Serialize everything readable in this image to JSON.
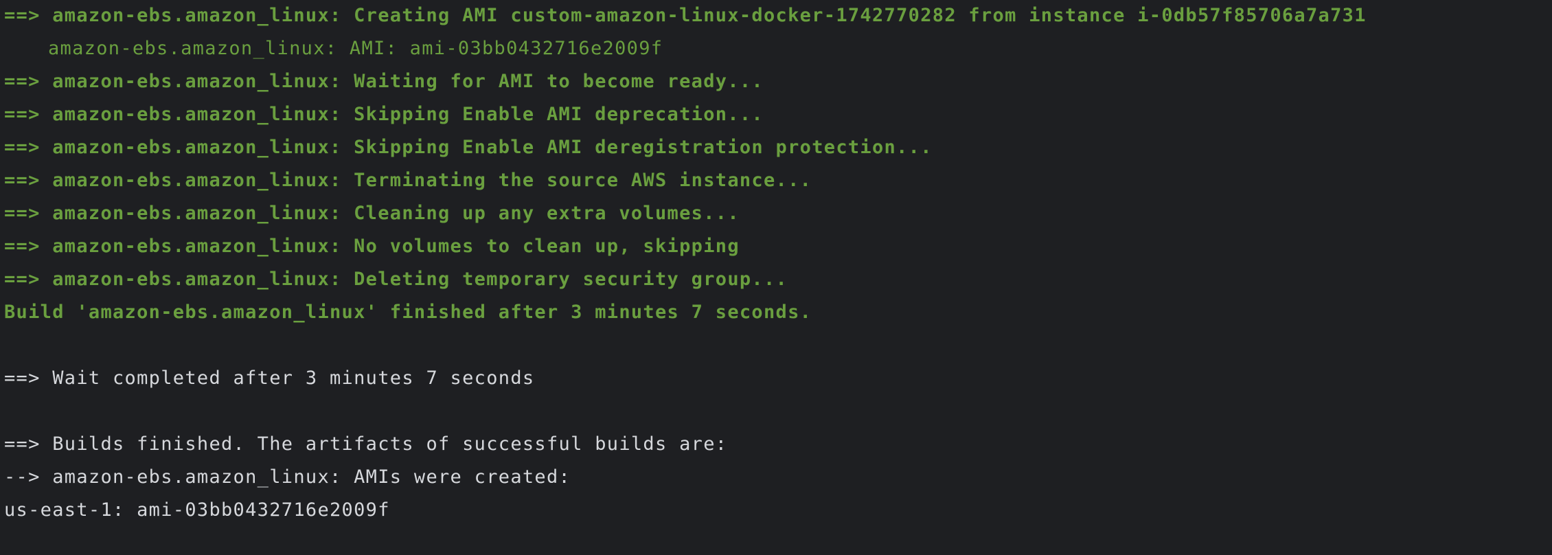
{
  "terminal": {
    "lines": [
      {
        "text": "==> amazon-ebs.amazon_linux: Creating AMI custom-amazon-linux-docker-1742770282 from instance i-0db57f85706a7a731",
        "style": "green-bold"
      },
      {
        "text": "amazon-ebs.amazon_linux: AMI: ami-03bb0432716e2009f",
        "style": "green"
      },
      {
        "text": "==> amazon-ebs.amazon_linux: Waiting for AMI to become ready...",
        "style": "green-bold"
      },
      {
        "text": "==> amazon-ebs.amazon_linux: Skipping Enable AMI deprecation...",
        "style": "green-bold"
      },
      {
        "text": "==> amazon-ebs.amazon_linux: Skipping Enable AMI deregistration protection...",
        "style": "green-bold"
      },
      {
        "text": "==> amazon-ebs.amazon_linux: Terminating the source AWS instance...",
        "style": "green-bold"
      },
      {
        "text": "==> amazon-ebs.amazon_linux: Cleaning up any extra volumes...",
        "style": "green-bold"
      },
      {
        "text": "==> amazon-ebs.amazon_linux: No volumes to clean up, skipping",
        "style": "green-bold"
      },
      {
        "text": "==> amazon-ebs.amazon_linux: Deleting temporary security group...",
        "style": "green-bold"
      },
      {
        "text": "Build 'amazon-ebs.amazon_linux' finished after 3 minutes 7 seconds.",
        "style": "green-bold"
      },
      {
        "text": "",
        "style": "plain"
      },
      {
        "text": "==> Wait completed after 3 minutes 7 seconds",
        "style": "plain"
      },
      {
        "text": "",
        "style": "plain"
      },
      {
        "text": "==> Builds finished. The artifacts of successful builds are:",
        "style": "plain"
      },
      {
        "text": "--> amazon-ebs.amazon_linux: AMIs were created:",
        "style": "plain"
      },
      {
        "text": "us-east-1: ami-03bb0432716e2009f",
        "style": "plain"
      }
    ]
  },
  "colors": {
    "background": "#1e1f22",
    "success_green": "#6a9f3f",
    "plain_text": "#d6d8dc"
  }
}
